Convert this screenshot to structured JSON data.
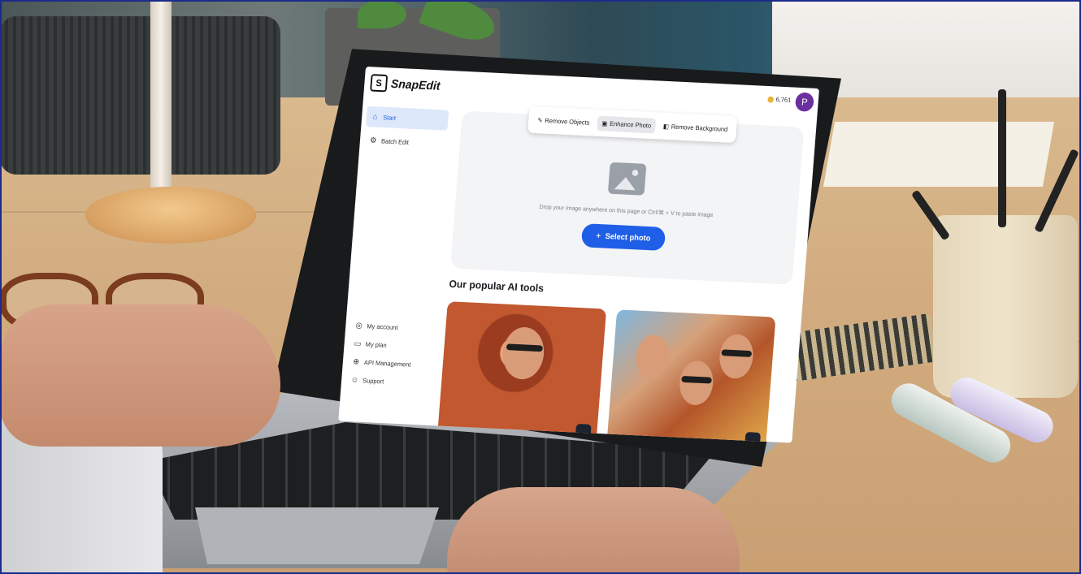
{
  "app": {
    "logo_mark": "S",
    "name": "SnapEdit",
    "credits": "6,761",
    "avatar_initial": "P"
  },
  "sidebar": {
    "items": [
      {
        "label": "Start",
        "icon": "home-icon",
        "active": true
      },
      {
        "label": "Batch Edit",
        "icon": "batch-icon",
        "active": false
      }
    ],
    "bottom_items": [
      {
        "label": "My account",
        "icon": "account-icon"
      },
      {
        "label": "My plan",
        "icon": "plan-icon"
      },
      {
        "label": "API Management",
        "icon": "api-icon"
      },
      {
        "label": "Support",
        "icon": "support-icon"
      }
    ]
  },
  "tabs": [
    {
      "label": "Remove Objects",
      "icon": "eraser-icon",
      "selected": false
    },
    {
      "label": "Enhance Photo",
      "icon": "enhance-icon",
      "selected": true
    },
    {
      "label": "Remove Background",
      "icon": "background-icon",
      "selected": false
    }
  ],
  "upload": {
    "hint": "Drop your image anywhere on this page or Ctrl/⌘ + V to paste image",
    "button_label": "Select photo",
    "button_icon": "plus-icon"
  },
  "section": {
    "title": "Our popular AI tools"
  },
  "colors": {
    "accent": "#1f5ee6",
    "avatar": "#6b2fa0",
    "active_bg": "#dde8fb"
  }
}
